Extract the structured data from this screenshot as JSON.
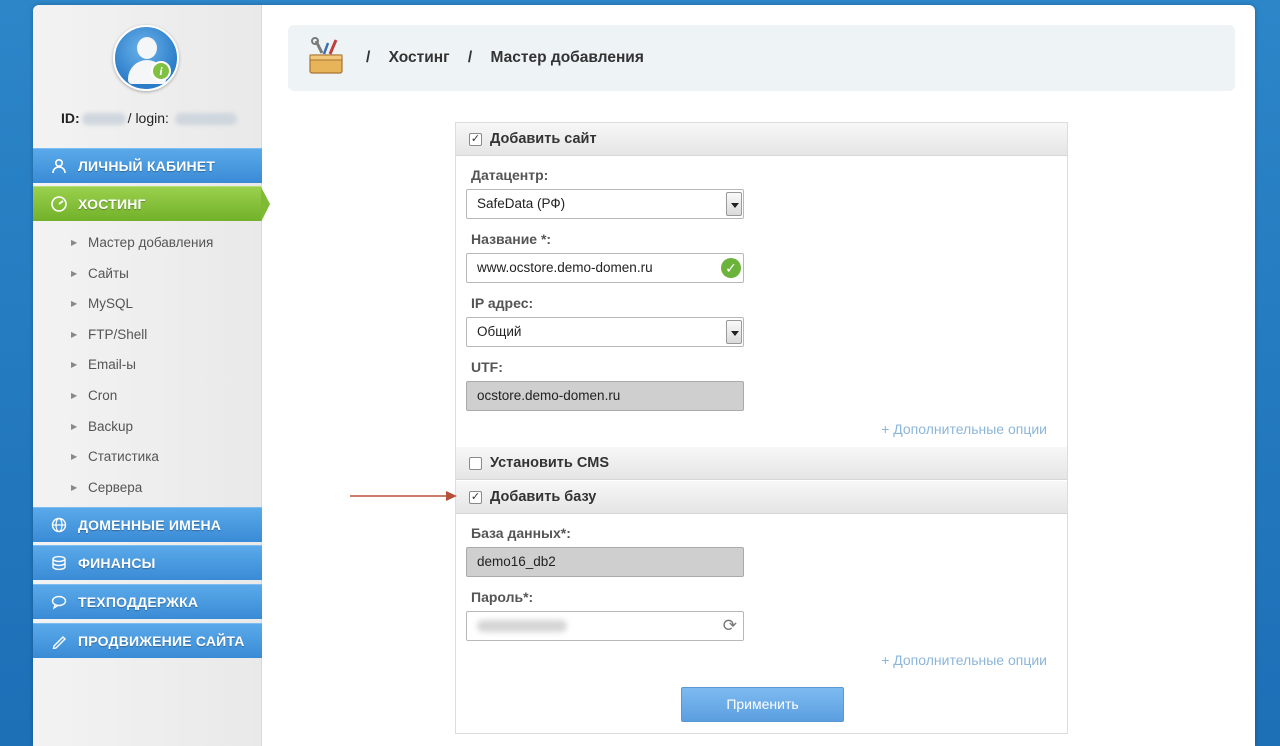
{
  "user": {
    "id_label": "ID:",
    "login_label": "/ login:"
  },
  "sidebar": {
    "nav": [
      {
        "label": "ЛИЧНЫЙ КАБИНЕТ",
        "icon": "user-icon"
      },
      {
        "label": "ХОСТИНГ",
        "icon": "gauge-icon"
      },
      {
        "label": "ДОМЕННЫЕ ИМЕНА",
        "icon": "globe-icon"
      },
      {
        "label": "ФИНАНСЫ",
        "icon": "coins-icon"
      },
      {
        "label": "ТЕХПОДДЕРЖКА",
        "icon": "chat-icon"
      },
      {
        "label": "ПРОДВИЖЕНИЕ САЙТА",
        "icon": "pencil-icon"
      }
    ],
    "submenu": [
      "Мастер добавления",
      "Сайты",
      "MySQL",
      "FTP/Shell",
      "Email-ы",
      "Cron",
      "Backup",
      "Статистика",
      "Сервера"
    ]
  },
  "breadcrumb": {
    "sep": "/",
    "items": [
      "Хостинг",
      "Мастер добавления"
    ]
  },
  "form": {
    "add_site": {
      "label": "Добавить сайт",
      "checked": true
    },
    "datacenter": {
      "label": "Датацентр:",
      "value": "SafeData (РФ)"
    },
    "name": {
      "label": "Название *:",
      "value": "www.ocstore.demo-domen.ru"
    },
    "ip": {
      "label": "IP адрес:",
      "value": "Общий"
    },
    "utf": {
      "label": "UTF:",
      "value": "ocstore.demo-domen.ru"
    },
    "more_options_1": "+ Дополнительные опции",
    "install_cms": {
      "label": "Установить CMS",
      "checked": false
    },
    "add_db": {
      "label": "Добавить базу",
      "checked": true
    },
    "database": {
      "label": "База данных*:",
      "value": "demo16_db2"
    },
    "password": {
      "label": "Пароль*:"
    },
    "more_options_2": "+ Дополнительные опции",
    "apply_label": "Применить"
  },
  "colors": {
    "nav_blue": "#3a8bd6",
    "nav_active_green": "#72b12a",
    "link": "#8cb6d9",
    "annotation_arrow": "#b5533a"
  }
}
